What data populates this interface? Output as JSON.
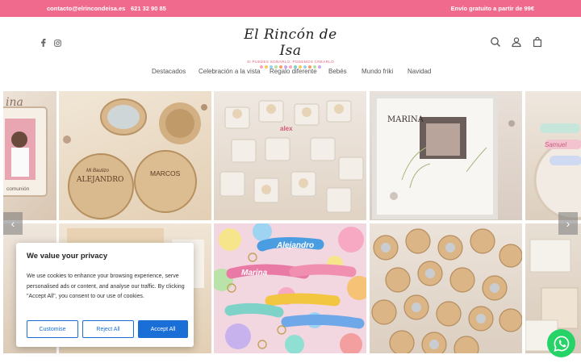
{
  "topbar": {
    "email": "contacto@elrincondeisa.es",
    "phone": "621 32 90 85",
    "shipping": "Envío gratuito a partir de 99€"
  },
  "social": {
    "facebook_icon": "facebook-icon",
    "instagram_icon": "instagram-icon"
  },
  "logo": {
    "title": "El Rincón de Isa",
    "tagline": "SI PUEDES SOÑARLO, PODEMOS CREARLO"
  },
  "header_icons": [
    "search-icon",
    "account-icon",
    "bag-icon"
  ],
  "nav": {
    "items": [
      "Destacados",
      "Celebración a la vista",
      "Regalo diferente",
      "Bebés",
      "Mundo friki",
      "Navidad"
    ]
  },
  "gallery": {
    "tiles": [
      {
        "label_main": "comunión"
      },
      {
        "label_main": "ALEJANDRO",
        "label_sub": "Mi Bautizo",
        "label_second": "MARCOS"
      },
      {
        "label_main": "alex"
      },
      {
        "label_main": "MARINA"
      },
      {
        "label_main": "Samuel"
      },
      {
        "label_main": ""
      },
      {
        "label_main": ""
      },
      {
        "label_main": "Alejandro",
        "label_sub": "Marina"
      },
      {
        "label_main": ""
      },
      {
        "label_main": ""
      }
    ],
    "arrow_prev": "‹",
    "arrow_next": "›"
  },
  "cookie": {
    "title": "We value your privacy",
    "text": "We use cookies to enhance your browsing experience, serve personalised ads or content, and analyse our traffic. By clicking \"Accept All\", you consent to our use of cookies.",
    "customise": "Customise",
    "reject": "Reject All",
    "accept": "Accept All"
  },
  "colors": {
    "topbar": "#f06a8e",
    "accent_blue": "#1a6fd6",
    "whatsapp": "#25d366"
  }
}
